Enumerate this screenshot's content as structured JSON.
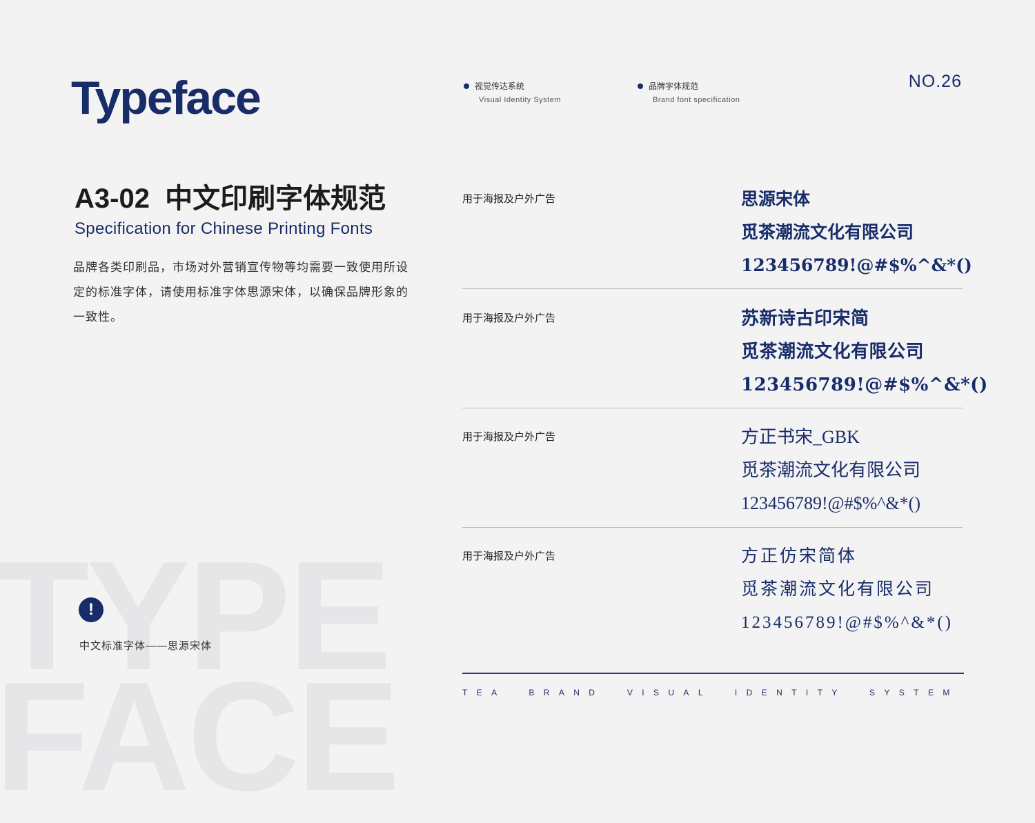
{
  "header": {
    "title": "Typeface",
    "nav": [
      {
        "cn": "视觉传达系统",
        "en": "Visual Identity System"
      },
      {
        "cn": "品牌字体规范",
        "en": "Brand font specification"
      }
    ],
    "page_number": "NO.26"
  },
  "section": {
    "code": "A3-02  中文印刷字体规范",
    "title_en": "Specification for Chinese Printing Fonts",
    "description": "品牌各类印刷品，市场对外营销宣传物等均需要一致使用所设定的标准字体，请使用标准字体思源宋体，以确保品牌形象的一致性。"
  },
  "note": {
    "icon": "exclamation-icon",
    "text": "中文标准字体——思源宋体"
  },
  "watermark": {
    "line1": "TYPE",
    "line2": "FACE"
  },
  "fonts": [
    {
      "usage": "用于海报及户外广告",
      "name": "思源宋体",
      "sample": "觅茶潮流文化有限公司",
      "chars": "123456789!@#$%^&*()"
    },
    {
      "usage": "用于海报及户外广告",
      "name": "苏新诗古印宋简",
      "sample": "觅茶潮流文化有限公司",
      "chars": "123456789!@#$%^&*()"
    },
    {
      "usage": "用于海报及户外广告",
      "name": "方正书宋_GBK",
      "sample": "觅茶潮流文化有限公司",
      "chars": "123456789!@#$%^&*()"
    },
    {
      "usage": "用于海报及户外广告",
      "name": "方正仿宋简体",
      "sample": "觅茶潮流文化有限公司",
      "chars": "123456789!@#$%^&*()"
    }
  ],
  "footer": "TEA  BRAND  VISUAL  IDENTITY  SYSTEM",
  "colors": {
    "brand": "#182c6a",
    "background": "#f3f3f4"
  }
}
